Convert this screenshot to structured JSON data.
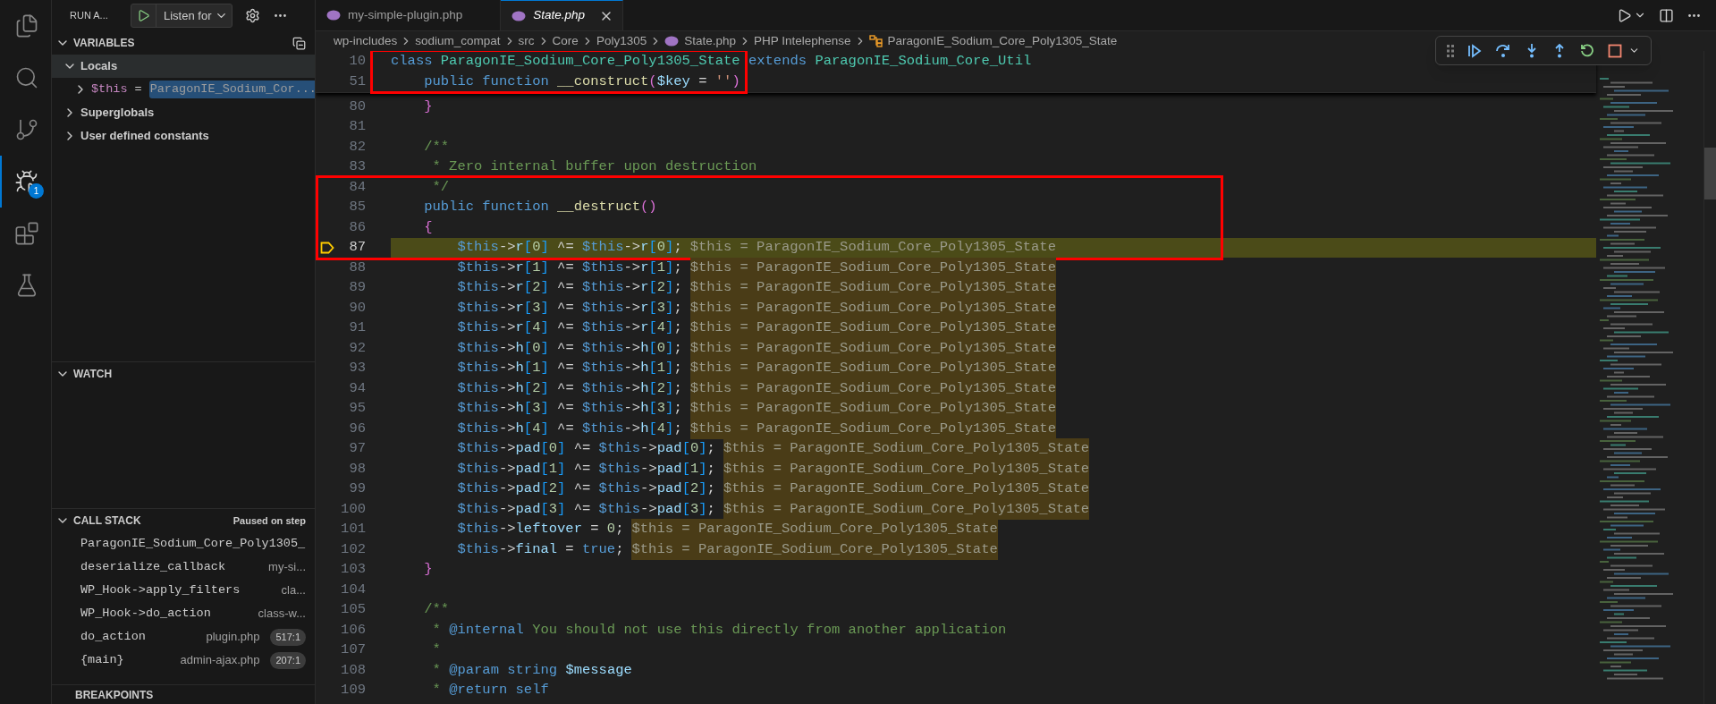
{
  "activity_bar": [
    {
      "kind": "explorer",
      "selected": false
    },
    {
      "kind": "search",
      "selected": false
    },
    {
      "kind": "source-control",
      "selected": false
    },
    {
      "kind": "run-debug",
      "selected": true,
      "badge": "1"
    },
    {
      "kind": "extensions",
      "selected": false
    },
    {
      "kind": "testing",
      "selected": false
    }
  ],
  "sidebar": {
    "title": "RUN A...",
    "launch_config": "Listen for",
    "variables": {
      "title": "VARIABLES",
      "expanded": true,
      "scopes": [
        {
          "label": "Locals",
          "expanded": true,
          "selected": true,
          "children": [
            {
              "name": "$this",
              "operator": "=",
              "value": "ParagonIE_Sodium_Cor...",
              "expanded": false,
              "value_selected": true
            }
          ]
        },
        {
          "label": "Superglobals",
          "expanded": false,
          "selected": false
        },
        {
          "label": "User defined constants",
          "expanded": false,
          "selected": false
        }
      ]
    },
    "watch": {
      "title": "WATCH",
      "expanded": true
    },
    "call_stack": {
      "title": "CALL STACK",
      "expanded": true,
      "status": "Paused on step",
      "frames": [
        {
          "function": "ParagonIE_Sodium_Core_Poly1305_"
        },
        {
          "function": "deserialize_callback",
          "file": "my-si..."
        },
        {
          "function": "WP_Hook->apply_filters",
          "file": "cla..."
        },
        {
          "function": "WP_Hook->do_action",
          "file": "class-w..."
        },
        {
          "function": "do_action",
          "file": "plugin.php",
          "line": "517:1"
        },
        {
          "function": "{main}",
          "file": "admin-ajax.php",
          "line": "207:1"
        }
      ]
    },
    "breakpoints": {
      "title": "BREAKPOINTS"
    }
  },
  "tabs": [
    {
      "label": "my-simple-plugin.php",
      "selected": false,
      "preview": false
    },
    {
      "label": "State.php",
      "selected": true,
      "preview": true
    }
  ],
  "breadcrumbs": [
    {
      "kind": "folder",
      "label": "wp-includes"
    },
    {
      "kind": "folder",
      "label": "sodium_compat"
    },
    {
      "kind": "folder",
      "label": "src"
    },
    {
      "kind": "folder",
      "label": "Core"
    },
    {
      "kind": "folder",
      "label": "Poly1305"
    },
    {
      "kind": "file",
      "label": "State.php"
    },
    {
      "kind": "text",
      "label": "PHP Intelephense"
    },
    {
      "kind": "class",
      "label": "ParagonIE_Sodium_Core_Poly1305_State"
    }
  ],
  "sticky": {
    "annotated": true,
    "lines": [
      {
        "number": "10",
        "current": false,
        "tokens": [
          {
            "kind": "kw",
            "text": "class "
          },
          {
            "kind": "cls",
            "text": "ParagonIE_Sodium_Core_Poly1305_State "
          },
          {
            "kind": "kw",
            "text": "extends "
          },
          {
            "kind": "cls",
            "text": "ParagonIE_Sodium_Core_Util"
          }
        ]
      },
      {
        "number": "51",
        "current": false,
        "tokens": [
          {
            "kind": "kw",
            "text": "    public function "
          },
          {
            "kind": "fn",
            "text": "__construct"
          },
          {
            "kind": "b2",
            "text": "("
          },
          {
            "kind": "var",
            "text": "$key"
          },
          {
            "kind": "op",
            "text": " = "
          },
          {
            "kind": "str",
            "text": "''"
          },
          {
            "kind": "b2",
            "text": ")"
          }
        ]
      }
    ]
  },
  "blocks": [
    {
      "annotated": false,
      "lines": [
        {
          "number": "80",
          "current": false,
          "tokens": [
            {
              "kind": "b2",
              "text": "    }"
            }
          ]
        },
        {
          "number": "81",
          "current": false
        },
        {
          "number": "82",
          "current": false,
          "tokens": [
            {
              "kind": "cmt",
              "text": "    /**"
            }
          ]
        },
        {
          "number": "83",
          "current": false,
          "tokens": [
            {
              "kind": "cmt",
              "text": "     * Zero internal buffer upon destruction"
            }
          ]
        }
      ]
    },
    {
      "annotated": true,
      "lines": [
        {
          "number": "84",
          "current": false,
          "tokens": [
            {
              "kind": "cmt",
              "text": "     */"
            }
          ]
        },
        {
          "number": "85",
          "current": false,
          "tokens": [
            {
              "kind": "kw",
              "text": "    public function "
            },
            {
              "kind": "fn",
              "text": "__destruct"
            },
            {
              "kind": "b2",
              "text": "()"
            }
          ]
        },
        {
          "number": "86",
          "current": false,
          "tokens": [
            {
              "kind": "b2",
              "text": "    {"
            }
          ]
        },
        {
          "number": "87",
          "current": true,
          "tokens": [
            {
              "kind": "kw",
              "text": "        $this"
            },
            {
              "kind": "op",
              "text": "->"
            },
            {
              "kind": "prop",
              "text": "r"
            },
            {
              "kind": "b3",
              "text": "["
            },
            {
              "kind": "num",
              "text": "0"
            },
            {
              "kind": "b3",
              "text": "]"
            },
            {
              "kind": "op",
              "text": " ^= "
            },
            {
              "kind": "kw",
              "text": "$this"
            },
            {
              "kind": "op",
              "text": "->"
            },
            {
              "kind": "prop",
              "text": "r"
            },
            {
              "kind": "b3",
              "text": "["
            },
            {
              "kind": "num",
              "text": "0"
            },
            {
              "kind": "b3",
              "text": "]"
            },
            {
              "kind": "op",
              "text": ";"
            }
          ],
          "inline_value": "$this = ParagonIE_Sodium_Core_Poly1305_State"
        }
      ]
    },
    {
      "annotated": false,
      "lines": [
        {
          "number": "88",
          "current": false,
          "tokens": [
            {
              "kind": "kw",
              "text": "        $this"
            },
            {
              "kind": "op",
              "text": "->"
            },
            {
              "kind": "prop",
              "text": "r"
            },
            {
              "kind": "b3",
              "text": "["
            },
            {
              "kind": "num",
              "text": "1"
            },
            {
              "kind": "b3",
              "text": "]"
            },
            {
              "kind": "op",
              "text": " ^= "
            },
            {
              "kind": "kw",
              "text": "$this"
            },
            {
              "kind": "op",
              "text": "->"
            },
            {
              "kind": "prop",
              "text": "r"
            },
            {
              "kind": "b3",
              "text": "["
            },
            {
              "kind": "num",
              "text": "1"
            },
            {
              "kind": "b3",
              "text": "]"
            },
            {
              "kind": "op",
              "text": ";"
            }
          ],
          "inline_value": "$this = ParagonIE_Sodium_Core_Poly1305_State"
        },
        {
          "number": "89",
          "current": false,
          "tokens": [
            {
              "kind": "kw",
              "text": "        $this"
            },
            {
              "kind": "op",
              "text": "->"
            },
            {
              "kind": "prop",
              "text": "r"
            },
            {
              "kind": "b3",
              "text": "["
            },
            {
              "kind": "num",
              "text": "2"
            },
            {
              "kind": "b3",
              "text": "]"
            },
            {
              "kind": "op",
              "text": " ^= "
            },
            {
              "kind": "kw",
              "text": "$this"
            },
            {
              "kind": "op",
              "text": "->"
            },
            {
              "kind": "prop",
              "text": "r"
            },
            {
              "kind": "b3",
              "text": "["
            },
            {
              "kind": "num",
              "text": "2"
            },
            {
              "kind": "b3",
              "text": "]"
            },
            {
              "kind": "op",
              "text": ";"
            }
          ],
          "inline_value": "$this = ParagonIE_Sodium_Core_Poly1305_State"
        },
        {
          "number": "90",
          "current": false,
          "tokens": [
            {
              "kind": "kw",
              "text": "        $this"
            },
            {
              "kind": "op",
              "text": "->"
            },
            {
              "kind": "prop",
              "text": "r"
            },
            {
              "kind": "b3",
              "text": "["
            },
            {
              "kind": "num",
              "text": "3"
            },
            {
              "kind": "b3",
              "text": "]"
            },
            {
              "kind": "op",
              "text": " ^= "
            },
            {
              "kind": "kw",
              "text": "$this"
            },
            {
              "kind": "op",
              "text": "->"
            },
            {
              "kind": "prop",
              "text": "r"
            },
            {
              "kind": "b3",
              "text": "["
            },
            {
              "kind": "num",
              "text": "3"
            },
            {
              "kind": "b3",
              "text": "]"
            },
            {
              "kind": "op",
              "text": ";"
            }
          ],
          "inline_value": "$this = ParagonIE_Sodium_Core_Poly1305_State"
        },
        {
          "number": "91",
          "current": false,
          "tokens": [
            {
              "kind": "kw",
              "text": "        $this"
            },
            {
              "kind": "op",
              "text": "->"
            },
            {
              "kind": "prop",
              "text": "r"
            },
            {
              "kind": "b3",
              "text": "["
            },
            {
              "kind": "num",
              "text": "4"
            },
            {
              "kind": "b3",
              "text": "]"
            },
            {
              "kind": "op",
              "text": " ^= "
            },
            {
              "kind": "kw",
              "text": "$this"
            },
            {
              "kind": "op",
              "text": "->"
            },
            {
              "kind": "prop",
              "text": "r"
            },
            {
              "kind": "b3",
              "text": "["
            },
            {
              "kind": "num",
              "text": "4"
            },
            {
              "kind": "b3",
              "text": "]"
            },
            {
              "kind": "op",
              "text": ";"
            }
          ],
          "inline_value": "$this = ParagonIE_Sodium_Core_Poly1305_State"
        },
        {
          "number": "92",
          "current": false,
          "tokens": [
            {
              "kind": "kw",
              "text": "        $this"
            },
            {
              "kind": "op",
              "text": "->"
            },
            {
              "kind": "prop",
              "text": "h"
            },
            {
              "kind": "b3",
              "text": "["
            },
            {
              "kind": "num",
              "text": "0"
            },
            {
              "kind": "b3",
              "text": "]"
            },
            {
              "kind": "op",
              "text": " ^= "
            },
            {
              "kind": "kw",
              "text": "$this"
            },
            {
              "kind": "op",
              "text": "->"
            },
            {
              "kind": "prop",
              "text": "h"
            },
            {
              "kind": "b3",
              "text": "["
            },
            {
              "kind": "num",
              "text": "0"
            },
            {
              "kind": "b3",
              "text": "]"
            },
            {
              "kind": "op",
              "text": ";"
            }
          ],
          "inline_value": "$this = ParagonIE_Sodium_Core_Poly1305_State"
        },
        {
          "number": "93",
          "current": false,
          "tokens": [
            {
              "kind": "kw",
              "text": "        $this"
            },
            {
              "kind": "op",
              "text": "->"
            },
            {
              "kind": "prop",
              "text": "h"
            },
            {
              "kind": "b3",
              "text": "["
            },
            {
              "kind": "num",
              "text": "1"
            },
            {
              "kind": "b3",
              "text": "]"
            },
            {
              "kind": "op",
              "text": " ^= "
            },
            {
              "kind": "kw",
              "text": "$this"
            },
            {
              "kind": "op",
              "text": "->"
            },
            {
              "kind": "prop",
              "text": "h"
            },
            {
              "kind": "b3",
              "text": "["
            },
            {
              "kind": "num",
              "text": "1"
            },
            {
              "kind": "b3",
              "text": "]"
            },
            {
              "kind": "op",
              "text": ";"
            }
          ],
          "inline_value": "$this = ParagonIE_Sodium_Core_Poly1305_State"
        },
        {
          "number": "94",
          "current": false,
          "tokens": [
            {
              "kind": "kw",
              "text": "        $this"
            },
            {
              "kind": "op",
              "text": "->"
            },
            {
              "kind": "prop",
              "text": "h"
            },
            {
              "kind": "b3",
              "text": "["
            },
            {
              "kind": "num",
              "text": "2"
            },
            {
              "kind": "b3",
              "text": "]"
            },
            {
              "kind": "op",
              "text": " ^= "
            },
            {
              "kind": "kw",
              "text": "$this"
            },
            {
              "kind": "op",
              "text": "->"
            },
            {
              "kind": "prop",
              "text": "h"
            },
            {
              "kind": "b3",
              "text": "["
            },
            {
              "kind": "num",
              "text": "2"
            },
            {
              "kind": "b3",
              "text": "]"
            },
            {
              "kind": "op",
              "text": ";"
            }
          ],
          "inline_value": "$this = ParagonIE_Sodium_Core_Poly1305_State"
        },
        {
          "number": "95",
          "current": false,
          "tokens": [
            {
              "kind": "kw",
              "text": "        $this"
            },
            {
              "kind": "op",
              "text": "->"
            },
            {
              "kind": "prop",
              "text": "h"
            },
            {
              "kind": "b3",
              "text": "["
            },
            {
              "kind": "num",
              "text": "3"
            },
            {
              "kind": "b3",
              "text": "]"
            },
            {
              "kind": "op",
              "text": " ^= "
            },
            {
              "kind": "kw",
              "text": "$this"
            },
            {
              "kind": "op",
              "text": "->"
            },
            {
              "kind": "prop",
              "text": "h"
            },
            {
              "kind": "b3",
              "text": "["
            },
            {
              "kind": "num",
              "text": "3"
            },
            {
              "kind": "b3",
              "text": "]"
            },
            {
              "kind": "op",
              "text": ";"
            }
          ],
          "inline_value": "$this = ParagonIE_Sodium_Core_Poly1305_State"
        },
        {
          "number": "96",
          "current": false,
          "tokens": [
            {
              "kind": "kw",
              "text": "        $this"
            },
            {
              "kind": "op",
              "text": "->"
            },
            {
              "kind": "prop",
              "text": "h"
            },
            {
              "kind": "b3",
              "text": "["
            },
            {
              "kind": "num",
              "text": "4"
            },
            {
              "kind": "b3",
              "text": "]"
            },
            {
              "kind": "op",
              "text": " ^= "
            },
            {
              "kind": "kw",
              "text": "$this"
            },
            {
              "kind": "op",
              "text": "->"
            },
            {
              "kind": "prop",
              "text": "h"
            },
            {
              "kind": "b3",
              "text": "["
            },
            {
              "kind": "num",
              "text": "4"
            },
            {
              "kind": "b3",
              "text": "]"
            },
            {
              "kind": "op",
              "text": ";"
            }
          ],
          "inline_value": "$this = ParagonIE_Sodium_Core_Poly1305_State"
        },
        {
          "number": "97",
          "current": false,
          "tokens": [
            {
              "kind": "kw",
              "text": "        $this"
            },
            {
              "kind": "op",
              "text": "->"
            },
            {
              "kind": "prop",
              "text": "pad"
            },
            {
              "kind": "b3",
              "text": "["
            },
            {
              "kind": "num",
              "text": "0"
            },
            {
              "kind": "b3",
              "text": "]"
            },
            {
              "kind": "op",
              "text": " ^= "
            },
            {
              "kind": "kw",
              "text": "$this"
            },
            {
              "kind": "op",
              "text": "->"
            },
            {
              "kind": "prop",
              "text": "pad"
            },
            {
              "kind": "b3",
              "text": "["
            },
            {
              "kind": "num",
              "text": "0"
            },
            {
              "kind": "b3",
              "text": "]"
            },
            {
              "kind": "op",
              "text": ";"
            }
          ],
          "inline_value": "$this = ParagonIE_Sodium_Core_Poly1305_State"
        },
        {
          "number": "98",
          "current": false,
          "tokens": [
            {
              "kind": "kw",
              "text": "        $this"
            },
            {
              "kind": "op",
              "text": "->"
            },
            {
              "kind": "prop",
              "text": "pad"
            },
            {
              "kind": "b3",
              "text": "["
            },
            {
              "kind": "num",
              "text": "1"
            },
            {
              "kind": "b3",
              "text": "]"
            },
            {
              "kind": "op",
              "text": " ^= "
            },
            {
              "kind": "kw",
              "text": "$this"
            },
            {
              "kind": "op",
              "text": "->"
            },
            {
              "kind": "prop",
              "text": "pad"
            },
            {
              "kind": "b3",
              "text": "["
            },
            {
              "kind": "num",
              "text": "1"
            },
            {
              "kind": "b3",
              "text": "]"
            },
            {
              "kind": "op",
              "text": ";"
            }
          ],
          "inline_value": "$this = ParagonIE_Sodium_Core_Poly1305_State"
        },
        {
          "number": "99",
          "current": false,
          "tokens": [
            {
              "kind": "kw",
              "text": "        $this"
            },
            {
              "kind": "op",
              "text": "->"
            },
            {
              "kind": "prop",
              "text": "pad"
            },
            {
              "kind": "b3",
              "text": "["
            },
            {
              "kind": "num",
              "text": "2"
            },
            {
              "kind": "b3",
              "text": "]"
            },
            {
              "kind": "op",
              "text": " ^= "
            },
            {
              "kind": "kw",
              "text": "$this"
            },
            {
              "kind": "op",
              "text": "->"
            },
            {
              "kind": "prop",
              "text": "pad"
            },
            {
              "kind": "b3",
              "text": "["
            },
            {
              "kind": "num",
              "text": "2"
            },
            {
              "kind": "b3",
              "text": "]"
            },
            {
              "kind": "op",
              "text": ";"
            }
          ],
          "inline_value": "$this = ParagonIE_Sodium_Core_Poly1305_State"
        },
        {
          "number": "100",
          "current": false,
          "tokens": [
            {
              "kind": "kw",
              "text": "        $this"
            },
            {
              "kind": "op",
              "text": "->"
            },
            {
              "kind": "prop",
              "text": "pad"
            },
            {
              "kind": "b3",
              "text": "["
            },
            {
              "kind": "num",
              "text": "3"
            },
            {
              "kind": "b3",
              "text": "]"
            },
            {
              "kind": "op",
              "text": " ^= "
            },
            {
              "kind": "kw",
              "text": "$this"
            },
            {
              "kind": "op",
              "text": "->"
            },
            {
              "kind": "prop",
              "text": "pad"
            },
            {
              "kind": "b3",
              "text": "["
            },
            {
              "kind": "num",
              "text": "3"
            },
            {
              "kind": "b3",
              "text": "]"
            },
            {
              "kind": "op",
              "text": ";"
            }
          ],
          "inline_value": "$this = ParagonIE_Sodium_Core_Poly1305_State"
        },
        {
          "number": "101",
          "current": false,
          "tokens": [
            {
              "kind": "kw",
              "text": "        $this"
            },
            {
              "kind": "op",
              "text": "->"
            },
            {
              "kind": "prop",
              "text": "leftover"
            },
            {
              "kind": "op",
              "text": " = "
            },
            {
              "kind": "num",
              "text": "0"
            },
            {
              "kind": "op",
              "text": ";"
            }
          ],
          "inline_value": "$this = ParagonIE_Sodium_Core_Poly1305_State"
        },
        {
          "number": "102",
          "current": false,
          "tokens": [
            {
              "kind": "kw",
              "text": "        $this"
            },
            {
              "kind": "op",
              "text": "->"
            },
            {
              "kind": "prop",
              "text": "final"
            },
            {
              "kind": "op",
              "text": " = "
            },
            {
              "kind": "kw",
              "text": "true"
            },
            {
              "kind": "op",
              "text": ";"
            }
          ],
          "inline_value": "$this = ParagonIE_Sodium_Core_Poly1305_State"
        },
        {
          "number": "103",
          "current": false,
          "tokens": [
            {
              "kind": "b2",
              "text": "    }"
            }
          ]
        },
        {
          "number": "104",
          "current": false
        },
        {
          "number": "105",
          "current": false,
          "tokens": [
            {
              "kind": "cmt",
              "text": "    /**"
            }
          ]
        },
        {
          "number": "106",
          "current": false,
          "tokens": [
            {
              "kind": "cmt",
              "text": "     * "
            },
            {
              "kind": "tag",
              "text": "@internal"
            },
            {
              "kind": "cmt",
              "text": " You should not use this directly from another application"
            }
          ]
        },
        {
          "number": "107",
          "current": false,
          "tokens": [
            {
              "kind": "cmt",
              "text": "     *"
            }
          ]
        },
        {
          "number": "108",
          "current": false,
          "tokens": [
            {
              "kind": "cmt",
              "text": "     * "
            },
            {
              "kind": "tag",
              "text": "@param "
            },
            {
              "kind": "kw",
              "text": "string "
            },
            {
              "kind": "var",
              "text": "$message"
            }
          ]
        },
        {
          "number": "109",
          "current": false,
          "tokens": [
            {
              "kind": "cmt",
              "text": "     * "
            },
            {
              "kind": "tag",
              "text": "@return "
            },
            {
              "kind": "kw",
              "text": "self"
            }
          ]
        }
      ]
    }
  ]
}
